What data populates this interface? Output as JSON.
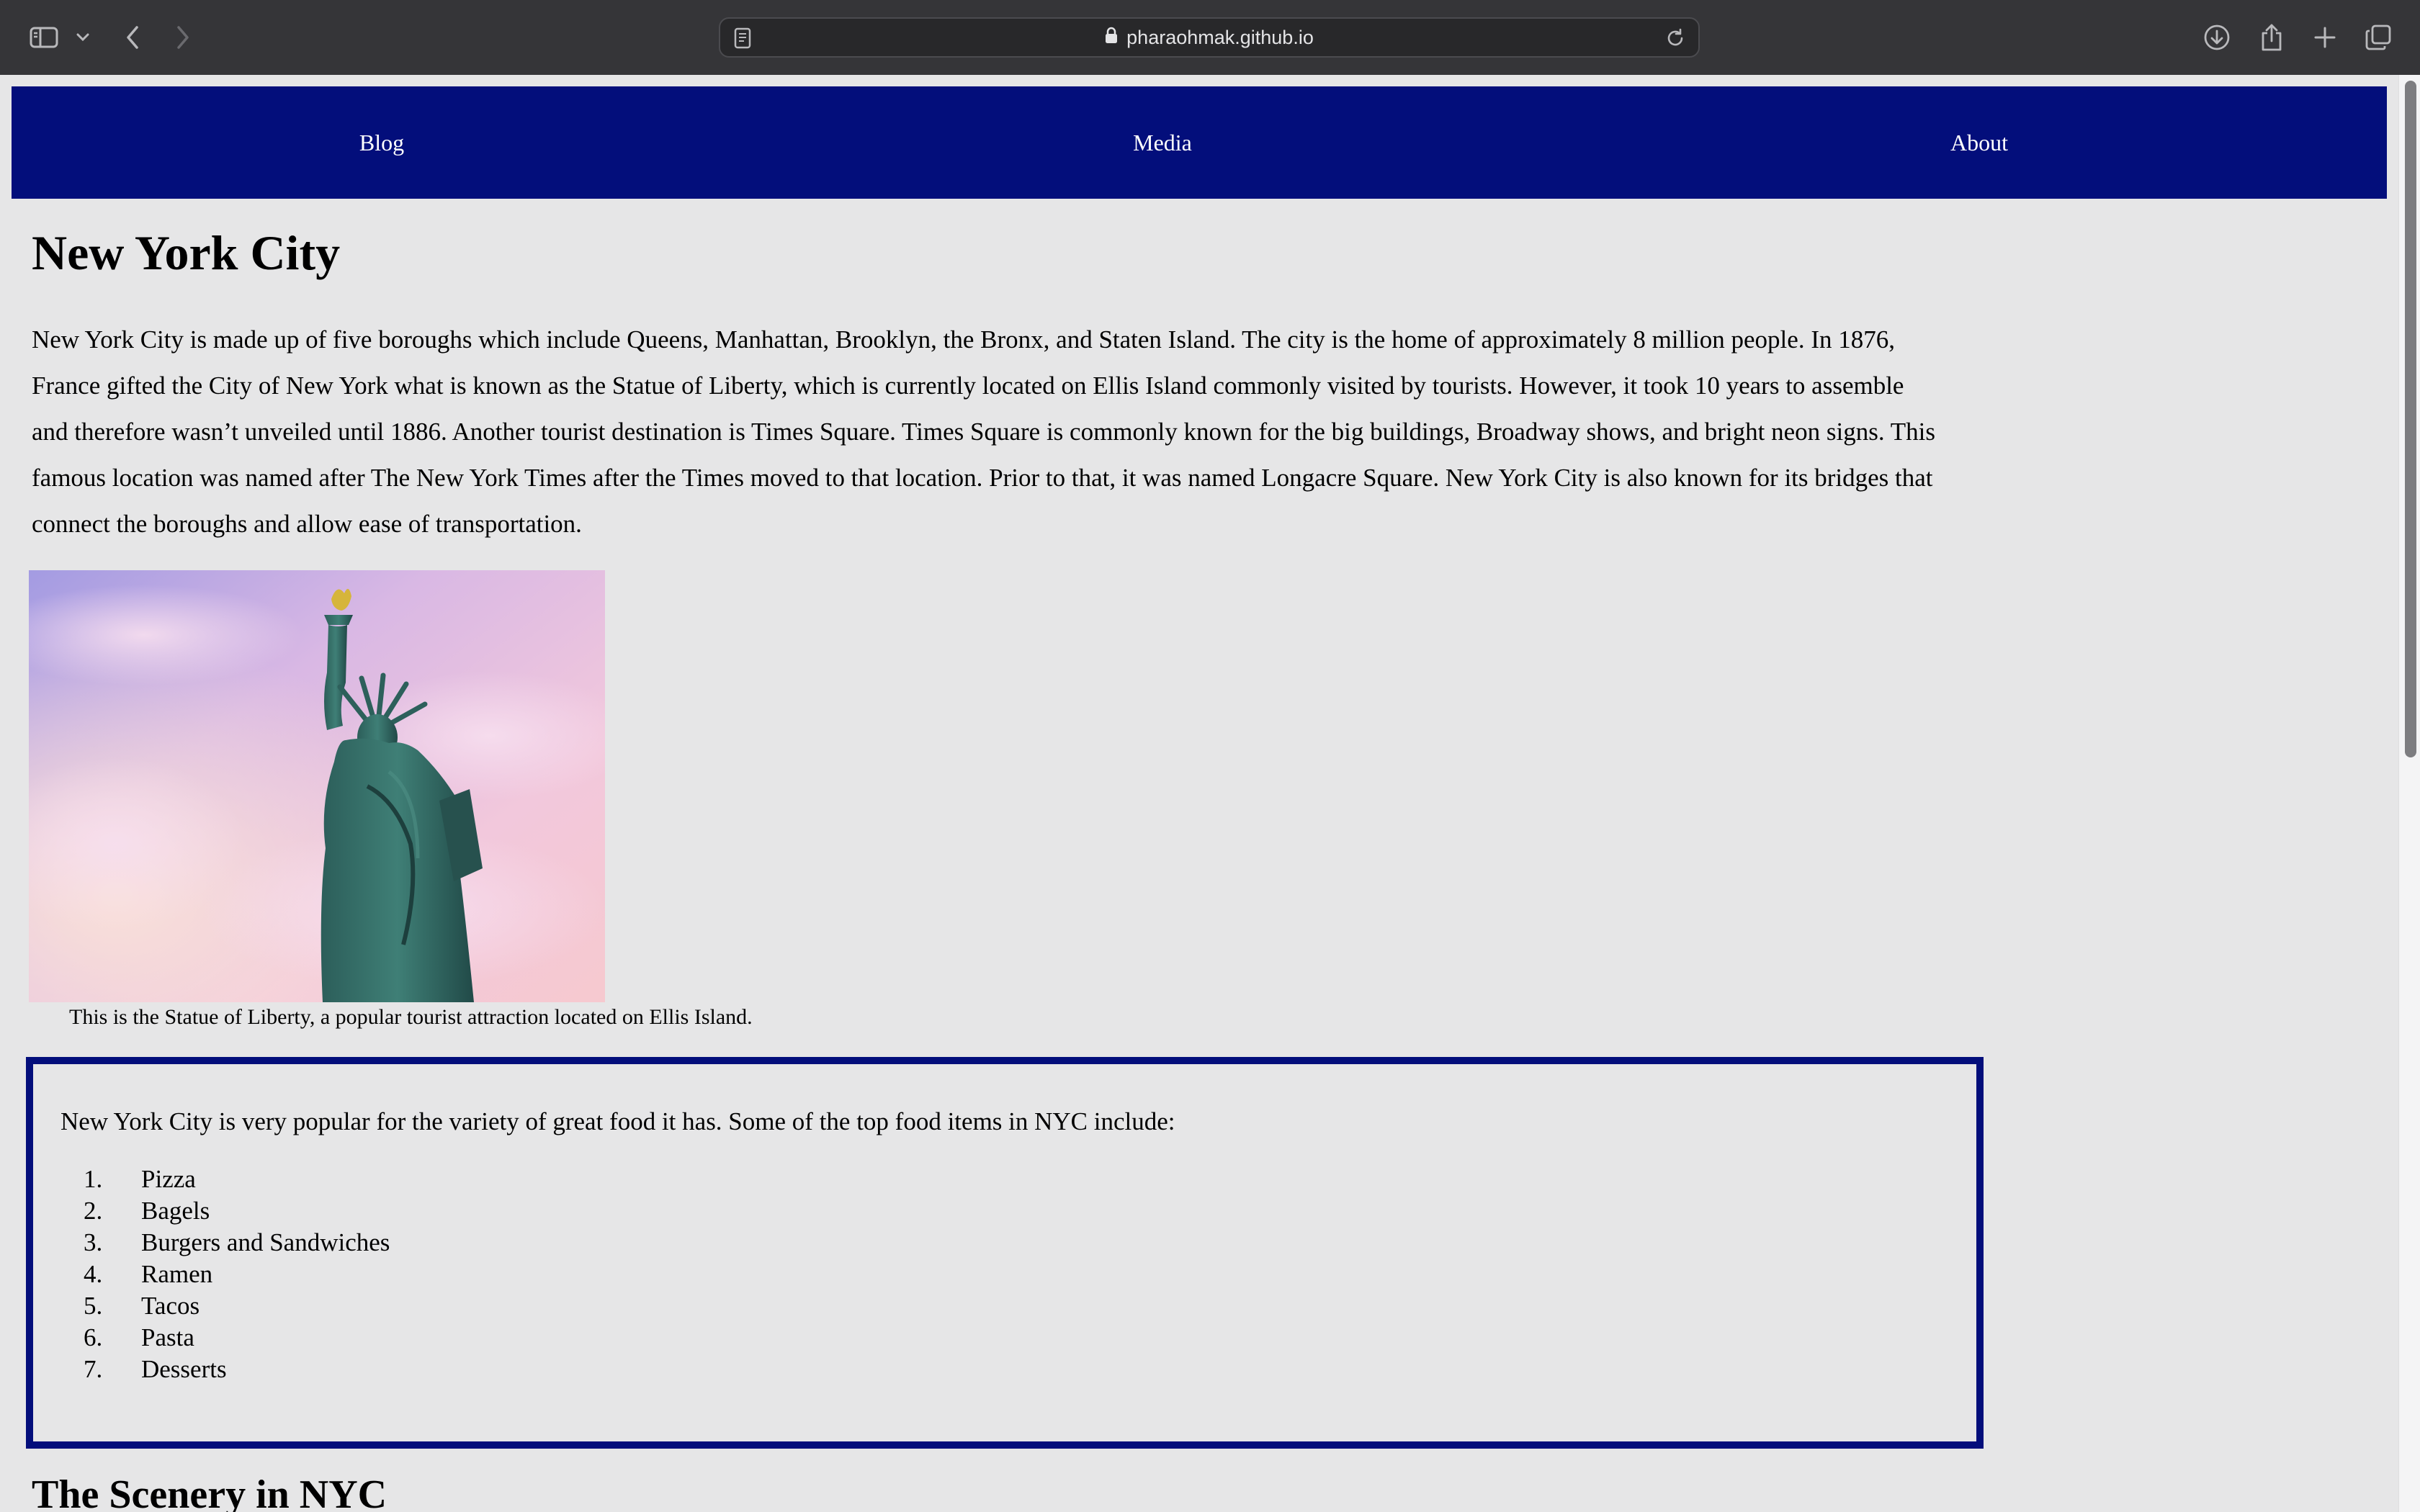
{
  "browser": {
    "url": "pharaohmak.github.io",
    "icons": [
      "sidebar-icon",
      "chevron-down-icon",
      "back-icon",
      "forward-icon",
      "reader-icon",
      "lock-icon",
      "reload-icon",
      "download-icon",
      "share-icon",
      "plus-icon",
      "tabs-icon"
    ]
  },
  "nav": {
    "links": [
      "Blog",
      "Media",
      "About"
    ],
    "background": "#030e7b"
  },
  "main": {
    "title": "New York City",
    "intro": "New York City is made up of five boroughs which include Queens, Manhattan, Brooklyn, the Bronx, and Staten Island. The city is the home of approximately 8 million people. In 1876, France gifted the City of New York what is known as the Statue of Liberty, which is currently located on Ellis Island commonly visited by tourists. However, it took 10 years to assemble and therefore wasn’t unveiled until 1886. Another tourist destination is Times Square. Times Square is commonly known for the big buildings, Broadway shows, and bright neon signs. This famous location was named after The New York Times after the Times moved to that location. Prior to that, it was named Longacre Square. New York City is also known for its bridges that connect the boroughs and allow ease of transportation.",
    "image_caption": "This is the Statue of Liberty, a popular tourist attraction located on Ellis Island.",
    "food": {
      "intro": "New York City is very popular for the variety of great food it has. Some of the top food items in NYC include:",
      "items": [
        {
          "num": "1.",
          "label": "Pizza"
        },
        {
          "num": "2.",
          "label": "Bagels"
        },
        {
          "num": "3.",
          "label": "Burgers and Sandwiches"
        },
        {
          "num": "4.",
          "label": "Ramen"
        },
        {
          "num": "5.",
          "label": "Tacos"
        },
        {
          "num": "6.",
          "label": "Pasta"
        },
        {
          "num": "7.",
          "label": "Desserts"
        }
      ]
    },
    "next_heading": "The Scenery in NYC"
  }
}
